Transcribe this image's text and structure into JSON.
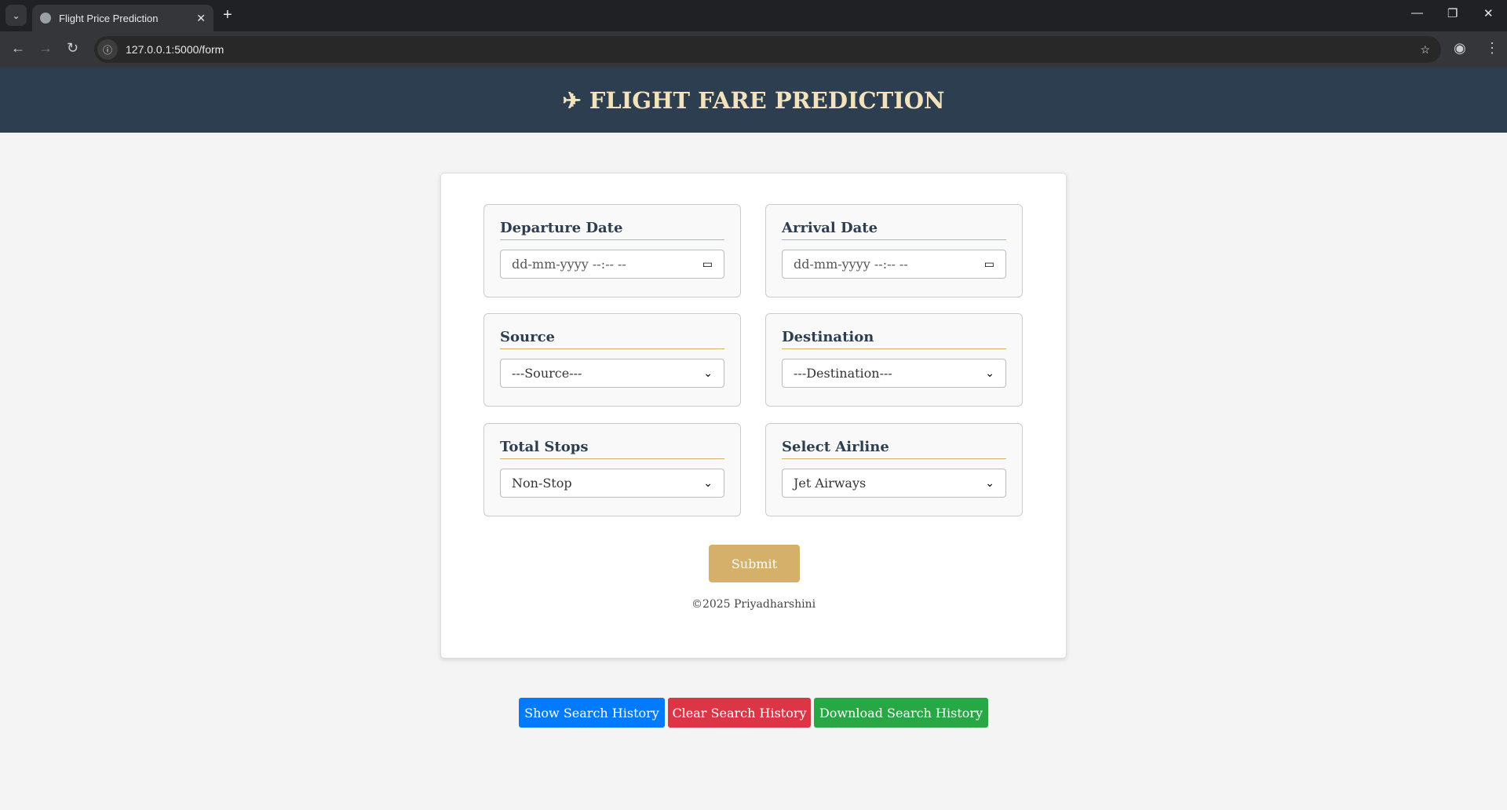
{
  "browser": {
    "tab_title": "Flight Price Prediction",
    "url": "127.0.0.1:5000/form"
  },
  "header": {
    "title": "FLIGHT FARE PREDICTION",
    "icon": "airplane-icon"
  },
  "form": {
    "departure": {
      "label": "Departure Date",
      "placeholder": "dd-mm-yyyy --:-- --"
    },
    "arrival": {
      "label": "Arrival Date",
      "placeholder": "dd-mm-yyyy --:-- --"
    },
    "source": {
      "label": "Source",
      "value": "---Source---"
    },
    "destination": {
      "label": "Destination",
      "value": "---Destination---"
    },
    "stops": {
      "label": "Total Stops",
      "value": "Non-Stop"
    },
    "airline": {
      "label": "Select Airline",
      "value": "Jet Airways"
    },
    "submit": "Submit",
    "footer": "©2025 Priyadharshini"
  },
  "actions": {
    "show": "Show Search History",
    "clear": "Clear Search History",
    "download": "Download Search History"
  },
  "colors": {
    "header": "#2c3e50",
    "accent": "#d4b06a",
    "show": "#007bff",
    "clear": "#dc3545",
    "download": "#28a745"
  }
}
